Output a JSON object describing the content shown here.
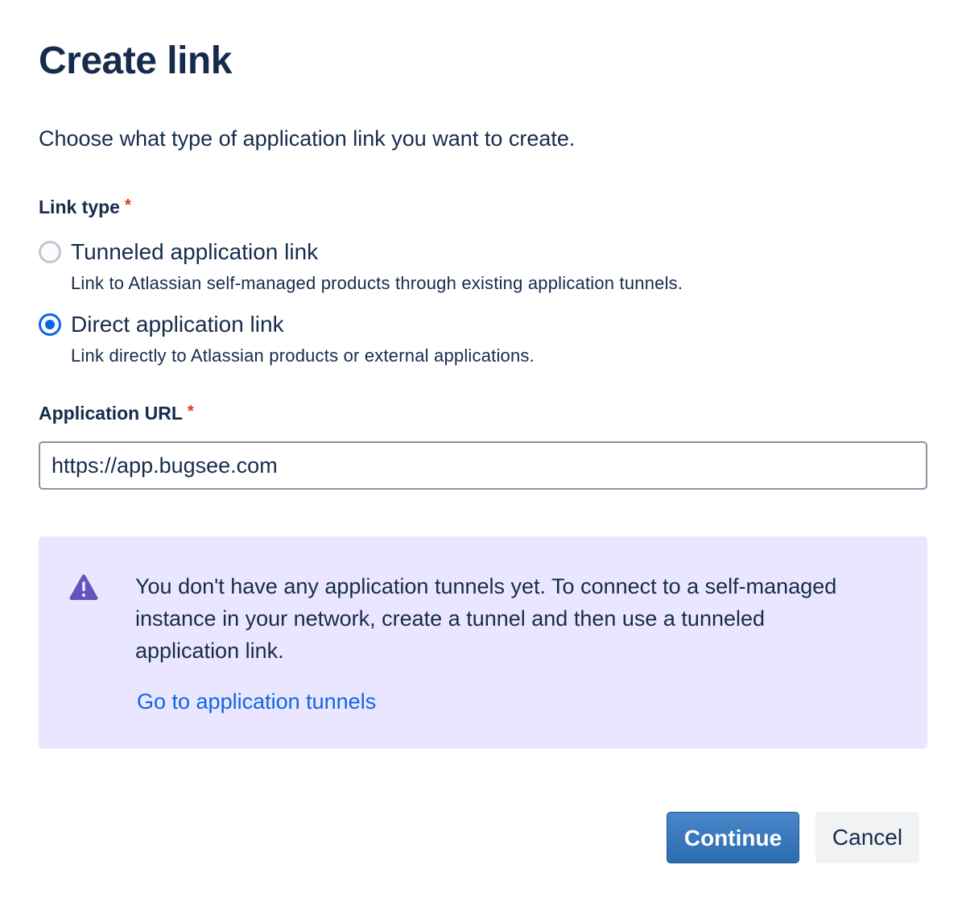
{
  "dialog": {
    "title": "Create link",
    "intro": "Choose what type of application link you want to create."
  },
  "link_type": {
    "label": "Link type",
    "required_marker": "*",
    "options": [
      {
        "title": "Tunneled application link",
        "description": "Link to Atlassian self-managed products through existing application tunnels.",
        "checked": false
      },
      {
        "title": "Direct application link",
        "description": "Link directly to Atlassian products or external applications.",
        "checked": true
      }
    ]
  },
  "application_url": {
    "label": "Application URL",
    "required_marker": "*",
    "value": "https://app.bugsee.com",
    "placeholder": ""
  },
  "notice": {
    "icon": "warning-icon",
    "text": "You don't have any application tunnels yet. To connect to a self-managed instance in your network, create a tunnel and then use a tunneled application link.",
    "link_label": "Go to application tunnels"
  },
  "footer": {
    "continue_label": "Continue",
    "cancel_label": "Cancel"
  },
  "colors": {
    "text": "#172b4d",
    "required": "#de350b",
    "accent": "#0c66e4",
    "notice_bg": "#eae6ff",
    "warning_icon": "#6554c0",
    "primary_button": "#2c6cb0"
  }
}
